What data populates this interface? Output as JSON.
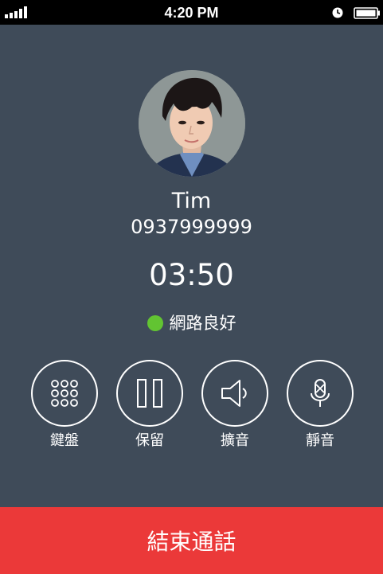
{
  "status_bar": {
    "time": "4:20 PM"
  },
  "contact": {
    "name": "Tim",
    "number": "0937999999",
    "avatar_icon": "contact-photo"
  },
  "call": {
    "timer": "03:50",
    "network_status": "網路良好",
    "network_color": "#62c432"
  },
  "actions": [
    {
      "label": "鍵盤",
      "icon": "keypad-icon"
    },
    {
      "label": "保留",
      "icon": "pause-icon"
    },
    {
      "label": "擴音",
      "icon": "speaker-icon"
    },
    {
      "label": "靜音",
      "icon": "microphone-mute-icon"
    }
  ],
  "end_call": {
    "label": "結束通話",
    "color": "#eb3939"
  },
  "colors": {
    "background": "#3f4b59",
    "status_bar": "#000000"
  }
}
